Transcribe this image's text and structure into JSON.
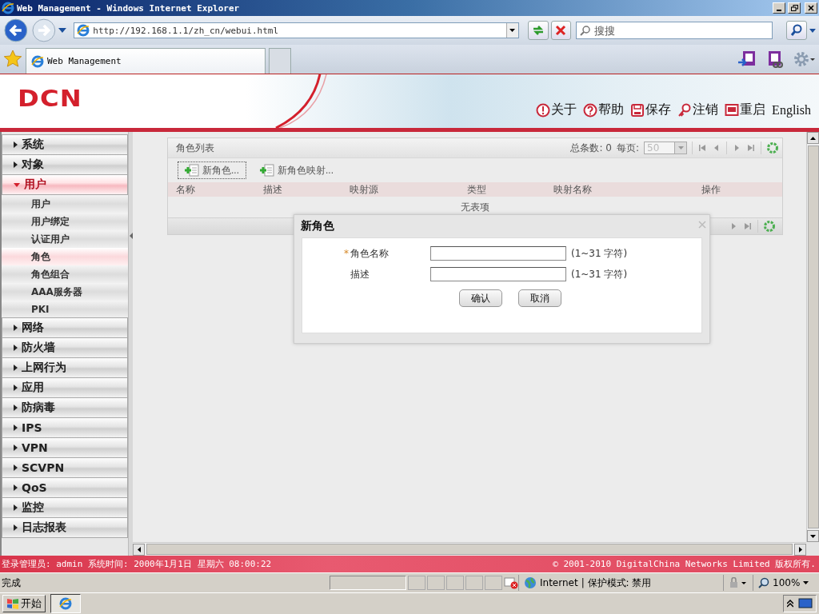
{
  "window": {
    "title": "Web Management - Windows Internet Explorer"
  },
  "address_bar": {
    "url": "http://192.168.1.1/zh_cn/webui.html"
  },
  "search": {
    "placeholder": "搜搜"
  },
  "tabs": [
    {
      "label": "Web Management",
      "selected": true
    }
  ],
  "header": {
    "logo": "DCN",
    "links": [
      {
        "kind": "about",
        "label": "关于"
      },
      {
        "kind": "help",
        "label": "帮助"
      },
      {
        "kind": "save",
        "label": "保存"
      },
      {
        "kind": "logout",
        "label": "注销"
      },
      {
        "kind": "reboot",
        "label": "重启"
      },
      {
        "kind": "text",
        "label": "English"
      }
    ]
  },
  "sidebar": {
    "items": [
      {
        "label": "系统",
        "expanded": false
      },
      {
        "label": "对象",
        "expanded": false
      },
      {
        "label": "用户",
        "expanded": true,
        "children": [
          {
            "label": "用户",
            "selected": false
          },
          {
            "label": "用户绑定",
            "selected": false
          },
          {
            "label": "认证用户",
            "selected": false
          },
          {
            "label": "角色",
            "selected": true
          },
          {
            "label": "角色组合",
            "selected": false
          },
          {
            "label": "AAA服务器",
            "selected": false
          },
          {
            "label": "PKI",
            "selected": false
          }
        ]
      },
      {
        "label": "网络",
        "expanded": false
      },
      {
        "label": "防火墙",
        "expanded": false
      },
      {
        "label": "上网行为",
        "expanded": false
      },
      {
        "label": "应用",
        "expanded": false
      },
      {
        "label": "防病毒",
        "expanded": false
      },
      {
        "label": "IPS",
        "expanded": false
      },
      {
        "label": "VPN",
        "expanded": false
      },
      {
        "label": "SCVPN",
        "expanded": false
      },
      {
        "label": "QoS",
        "expanded": false
      },
      {
        "label": "监控",
        "expanded": false
      },
      {
        "label": "日志报表",
        "expanded": false
      }
    ]
  },
  "role_list": {
    "title": "角色列表",
    "total_label": "总条数:",
    "total": "0",
    "per_page_label": "每页:",
    "per_page": {
      "value": "50",
      "disabled": true
    },
    "actions": [
      {
        "label": "新角色...",
        "focused": true
      },
      {
        "label": "新角色映射...",
        "focused": false
      }
    ],
    "columns": [
      "名称",
      "描述",
      "映射源",
      "类型",
      "映射名称",
      "操作"
    ],
    "empty_text": "无表项"
  },
  "dialog": {
    "title": "新角色",
    "fields": [
      {
        "mark": "*",
        "label": "角色名称",
        "hint": "(1~31 字符)"
      },
      {
        "label": "描述",
        "hint": "(1~31 字符)"
      }
    ],
    "buttons": [
      "确认",
      "取消"
    ]
  },
  "footer": {
    "session": "登录管理员: admin 系统时间: 2000年1月1日 星期六 08:00:22",
    "copyright": "© 2001-2010 DigitalChina Networks Limited 版权所有."
  },
  "status_bar": {
    "status": "完成",
    "zone": "Internet",
    "protected_mode": "| 保护模式: 禁用",
    "zoom": "100%"
  },
  "taskbar": {
    "start": "开始"
  }
}
